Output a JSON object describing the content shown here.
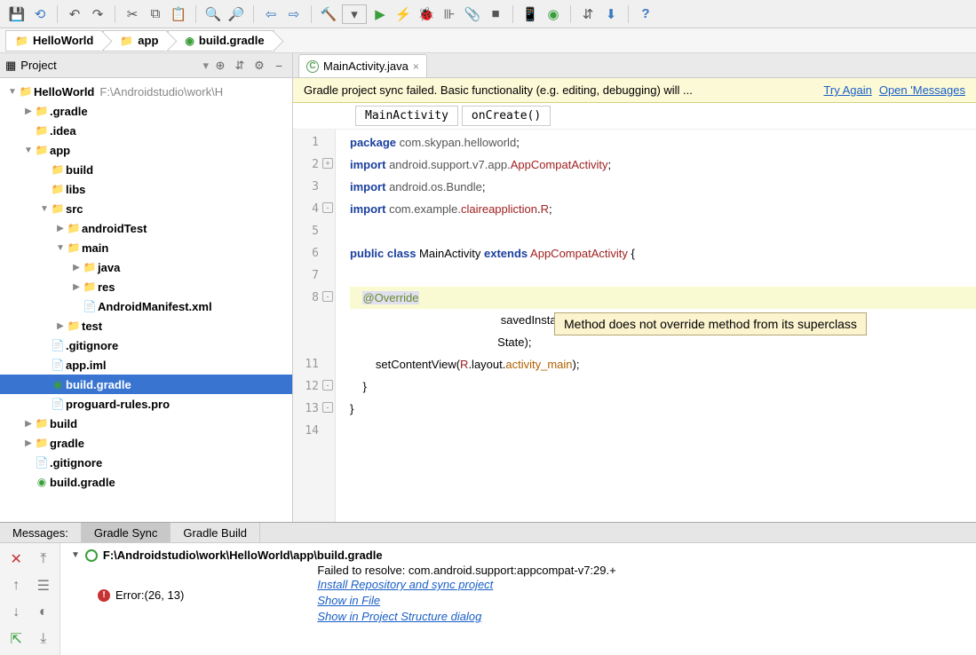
{
  "toolbar": {
    "icons": [
      "save",
      "refresh",
      "undo",
      "redo",
      "cut",
      "copy",
      "paste",
      "zoom-in",
      "zoom-out",
      "back",
      "forward",
      "build",
      "dropdown",
      "run",
      "flash",
      "debug",
      "profile",
      "attach",
      "stop",
      "avd",
      "sdk",
      "sync",
      "download",
      "help"
    ]
  },
  "breadcrumb": {
    "items": [
      {
        "icon": "folder",
        "label": "HelloWorld"
      },
      {
        "icon": "folder",
        "label": "app"
      },
      {
        "icon": "gradle",
        "label": "build.gradle"
      }
    ]
  },
  "project": {
    "title": "Project",
    "tree": [
      {
        "d": 0,
        "arr": "▼",
        "icon": "📁",
        "iconCls": "folder-icon",
        "name": "HelloWorld",
        "path": "F:\\Androidstudio\\work\\H"
      },
      {
        "d": 1,
        "arr": "▶",
        "icon": "📁",
        "iconCls": "folder-icon",
        "name": ".gradle"
      },
      {
        "d": 1,
        "arr": "",
        "icon": "📁",
        "iconCls": "folder-icon",
        "name": ".idea"
      },
      {
        "d": 1,
        "arr": "▼",
        "icon": "📁",
        "iconCls": "folder-icon",
        "name": "app"
      },
      {
        "d": 2,
        "arr": "",
        "icon": "📁",
        "iconCls": "folder-icon",
        "name": "build"
      },
      {
        "d": 2,
        "arr": "",
        "icon": "📁",
        "iconCls": "folder-icon",
        "name": "libs"
      },
      {
        "d": 2,
        "arr": "▼",
        "icon": "📁",
        "iconCls": "folder-icon",
        "name": "src"
      },
      {
        "d": 3,
        "arr": "▶",
        "icon": "📁",
        "iconCls": "folder-icon",
        "name": "androidTest"
      },
      {
        "d": 3,
        "arr": "▼",
        "icon": "📁",
        "iconCls": "folder-icon",
        "name": "main"
      },
      {
        "d": 4,
        "arr": "▶",
        "icon": "📁",
        "iconCls": "folder-icon blue",
        "name": "java"
      },
      {
        "d": 4,
        "arr": "▶",
        "icon": "📁",
        "iconCls": "folder-icon",
        "name": "res"
      },
      {
        "d": 4,
        "arr": "",
        "icon": "📄",
        "iconCls": "file-icon",
        "name": "AndroidManifest.xml"
      },
      {
        "d": 3,
        "arr": "▶",
        "icon": "📁",
        "iconCls": "folder-icon",
        "name": "test"
      },
      {
        "d": 2,
        "arr": "",
        "icon": "📄",
        "iconCls": "file-icon",
        "name": ".gitignore"
      },
      {
        "d": 2,
        "arr": "",
        "icon": "📄",
        "iconCls": "file-icon",
        "name": "app.iml"
      },
      {
        "d": 2,
        "arr": "",
        "icon": "◉",
        "iconCls": "gradle-icon-c",
        "name": "build.gradle",
        "selected": true
      },
      {
        "d": 2,
        "arr": "",
        "icon": "📄",
        "iconCls": "file-icon",
        "name": "proguard-rules.pro"
      },
      {
        "d": 1,
        "arr": "▶",
        "icon": "📁",
        "iconCls": "folder-icon",
        "name": "build"
      },
      {
        "d": 1,
        "arr": "▶",
        "icon": "📁",
        "iconCls": "folder-icon",
        "name": "gradle"
      },
      {
        "d": 1,
        "arr": "",
        "icon": "📄",
        "iconCls": "file-icon",
        "name": ".gitignore"
      },
      {
        "d": 1,
        "arr": "",
        "icon": "◉",
        "iconCls": "gradle-icon-c",
        "name": "build.gradle"
      }
    ]
  },
  "editor": {
    "tab": {
      "icon": "C",
      "label": "MainActivity.java"
    },
    "banner": {
      "msg": "Gradle project sync failed. Basic functionality (e.g. editing, debugging) will ...",
      "link1": "Try Again",
      "link2": "Open 'Messages"
    },
    "nav": {
      "cls": "MainActivity",
      "method": "onCreate()"
    },
    "tooltip": "Method does not override method from its superclass",
    "lines": [
      {
        "n": 1,
        "html": "<span class='kw'>package</span> <span class='pkg'>com.skypan.helloworld</span>;"
      },
      {
        "n": 2,
        "mark": "+",
        "html": "<span class='kw'>import</span> <span class='pkg'>android.support.v7.app.</span><span class='cls'>AppCompatActivity</span>;"
      },
      {
        "n": 3,
        "html": "<span class='kw'>import</span> <span class='pkg'>android.os.Bundle</span>;"
      },
      {
        "n": 4,
        "mark": "-",
        "html": "<span class='kw'>import</span> <span class='pkg'>com.example.</span><span class='cls'>claireappliction</span>.<span class='cls'>R</span>;"
      },
      {
        "n": 5,
        "html": ""
      },
      {
        "n": 6,
        "html": "<span class='kw'>public class</span> MainActivity <span class='kw'>extends</span> <span class='cls'>AppCompatActivity</span> {"
      },
      {
        "n": 7,
        "html": ""
      },
      {
        "n": 8,
        "mark": "-",
        "hl": true,
        "html": "    <span class='ann'>@Override</span>"
      },
      {
        "n": "",
        "html": "                                               savedInstanceState) {"
      },
      {
        "n": "",
        "html": "                                              State);"
      },
      {
        "n": 11,
        "html": "        setContentView(<span class='cls'>R</span>.layout.<span class='str'>activity_main</span>);"
      },
      {
        "n": 12,
        "mark": "-",
        "html": "    }"
      },
      {
        "n": 13,
        "mark": "-",
        "html": "}"
      },
      {
        "n": 14,
        "html": ""
      }
    ]
  },
  "bottom": {
    "tab1": "Messages:",
    "tab2": "Gradle Sync",
    "tab3": "Gradle Build",
    "header": "F:\\Androidstudio\\work\\HelloWorld\\app\\build.gradle",
    "error_label": "Error:(26, 13)",
    "fail_msg": "Failed to resolve: com.android.support:appcompat-v7:29.+",
    "link1": "Install Repository and sync project",
    "link2": "Show in File",
    "link3": "Show in Project Structure dialog"
  }
}
